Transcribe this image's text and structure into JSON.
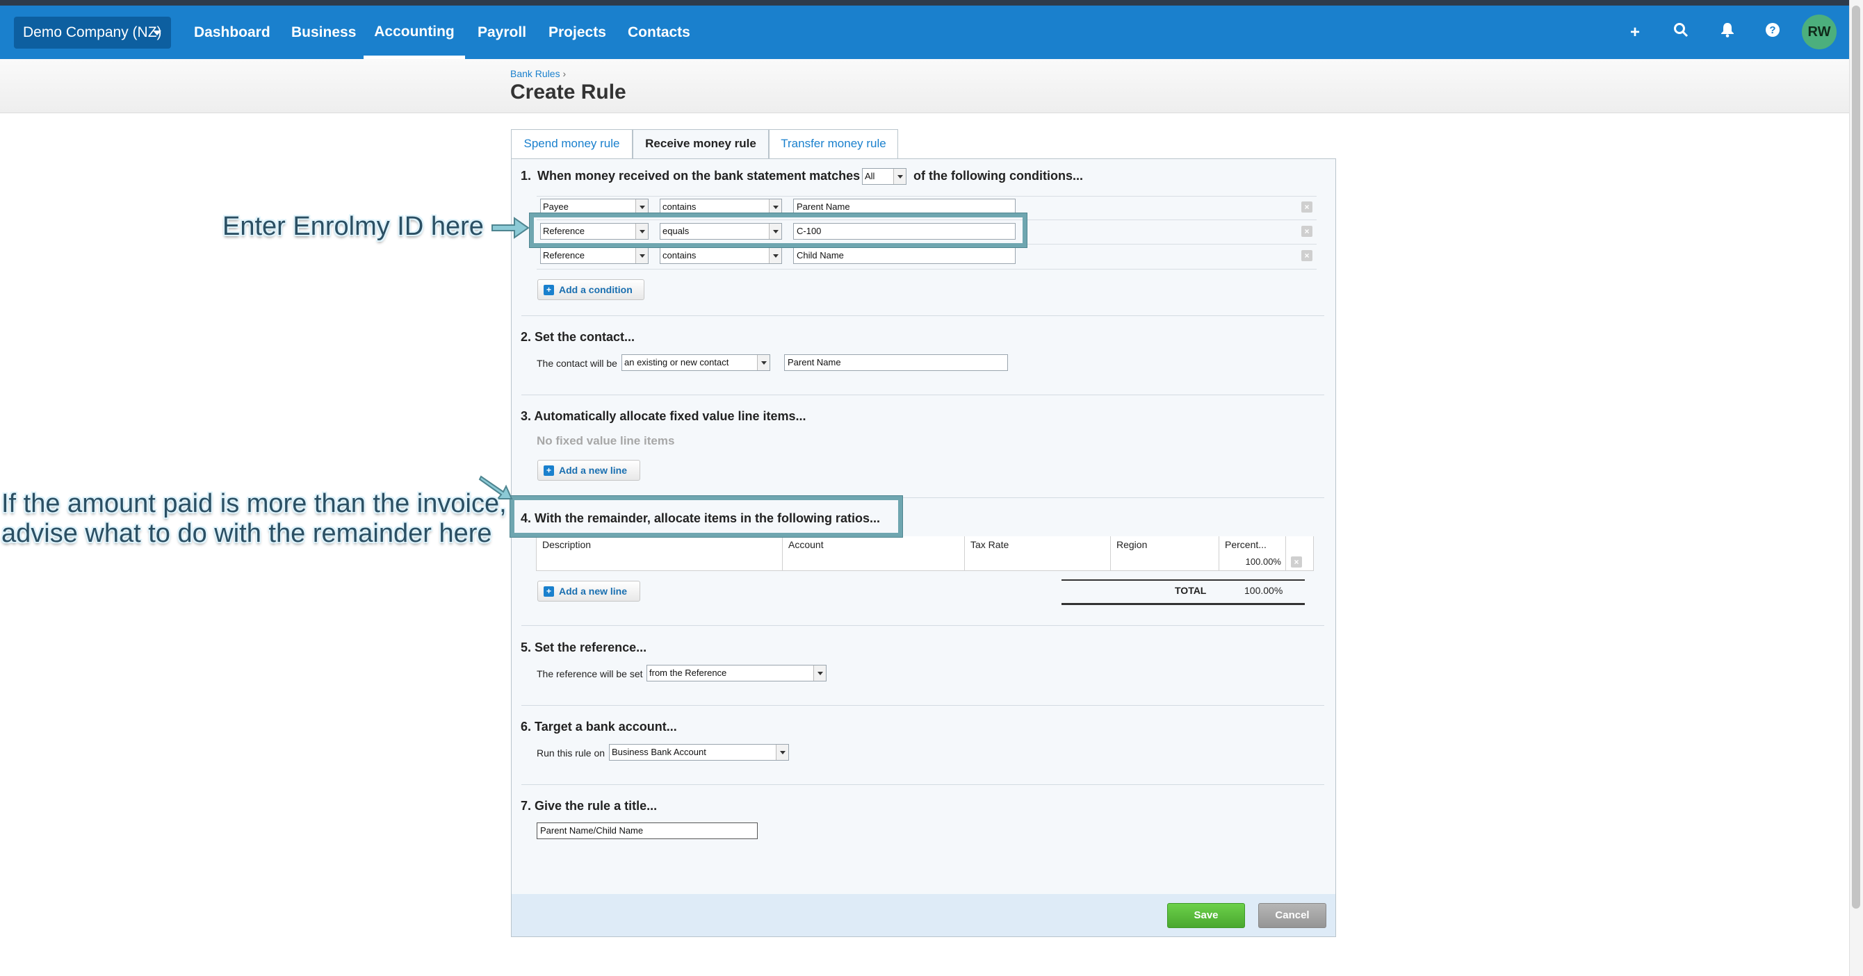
{
  "nav": {
    "org": "Demo Company (NZ)",
    "items": [
      "Dashboard",
      "Business",
      "Accounting",
      "Payroll",
      "Projects",
      "Contacts"
    ],
    "active": "Accounting",
    "avatar": "RW",
    "icons": [
      "plus-icon",
      "search-icon",
      "bell-icon",
      "help-icon"
    ]
  },
  "header": {
    "breadcrumb": "Bank Rules",
    "breadcrumb_sep": "›",
    "title": "Create Rule"
  },
  "tabs": [
    "Spend money rule",
    "Receive money rule",
    "Transfer money rule"
  ],
  "active_tab": "Receive money rule",
  "section1": {
    "num": "1.",
    "text_before": "When money received on the bank statement matches",
    "match": "All",
    "text_after": "of the following conditions...",
    "conditions": [
      {
        "field": "Payee",
        "operator": "contains",
        "value": "Parent Name"
      },
      {
        "field": "Reference",
        "operator": "equals",
        "value": "C-100"
      },
      {
        "field": "Reference",
        "operator": "contains",
        "value": "Child Name"
      }
    ],
    "add_label": "Add a condition"
  },
  "section2": {
    "num": "2.",
    "title": "Set the contact...",
    "label": "The contact will be",
    "select": "an existing or new contact",
    "value": "Parent Name"
  },
  "section3": {
    "num": "3.",
    "title": "Automatically allocate fixed value line items...",
    "empty": "No fixed value line items",
    "add_label": "Add a new line"
  },
  "section4": {
    "num": "4.",
    "title": "With the remainder, allocate items in the following ratios...",
    "columns": [
      "Description",
      "Account",
      "Tax Rate",
      "Region",
      "Percent..."
    ],
    "row_percent": "100.00%",
    "add_label": "Add a new line",
    "total_label": "TOTAL",
    "total_value": "100.00%"
  },
  "section5": {
    "num": "5.",
    "title": "Set the reference...",
    "label": "The reference will be set",
    "select": "from the Reference"
  },
  "section6": {
    "num": "6.",
    "title": "Target a bank account...",
    "label": "Run this rule on",
    "select": "Business Bank Account"
  },
  "section7": {
    "num": "7.",
    "title": "Give the rule a title...",
    "value": "Parent Name/Child Name"
  },
  "buttons": {
    "save": "Save",
    "cancel": "Cancel"
  },
  "annotations": {
    "enrolmy": "Enter Enrolmy ID here",
    "remainder_line1": "If the amount paid is more than the invoice,",
    "remainder_line2": "advise what to do with the remainder here"
  },
  "colors": {
    "nav": "#1a80cd",
    "save": "#5bbd3a",
    "cancel": "#a3a3a3",
    "callout": "#6fa6b0"
  }
}
